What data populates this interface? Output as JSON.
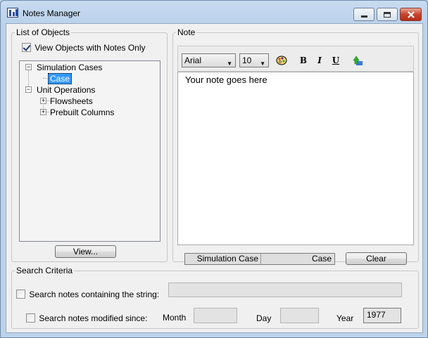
{
  "window": {
    "title": "Notes Manager"
  },
  "list_panel": {
    "label": "List of Objects",
    "filter_checkbox": {
      "label": "View Objects with Notes Only",
      "checked": true
    },
    "tree": {
      "simulation_cases": {
        "label": "Simulation Cases",
        "expander": "−",
        "child": "Case"
      },
      "unit_operations": {
        "label": "Unit Operations",
        "expander": "−",
        "children": [
          {
            "label": "Flowsheets",
            "expander": "+"
          },
          {
            "label": "Prebuilt Columns",
            "expander": "+"
          }
        ]
      }
    },
    "view_button": "View..."
  },
  "note_panel": {
    "label": "Note",
    "font_family": "Arial",
    "font_size": "10",
    "bold_label": "B",
    "italic_label": "I",
    "underline_label": "U",
    "editor_text": "Your note goes here",
    "status": {
      "left": "Simulation Case",
      "right": "Case"
    },
    "clear_button": "Clear"
  },
  "search": {
    "label": "Search Criteria",
    "string_checkbox": {
      "label": "Search notes containing the string:",
      "checked": false,
      "value": ""
    },
    "date_checkbox": {
      "label": "Search notes modified since:",
      "checked": false
    },
    "month_label": "Month",
    "month_value": "",
    "day_label": "Day",
    "day_value": "",
    "year_label": "Year",
    "year_value": "1977"
  },
  "colors": {
    "selection": "#3399ff",
    "titlebar": "#bcd3ec",
    "close_button": "#c7452f"
  },
  "icons": {
    "app": "notes-manager-icon",
    "minimize": "minimize-icon",
    "maximize": "maximize-icon",
    "close": "close-icon",
    "palette": "color-palette-icon",
    "up_arrow": "up-arrow-icon"
  }
}
